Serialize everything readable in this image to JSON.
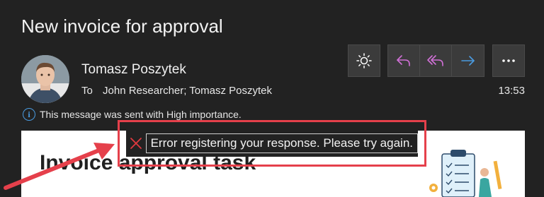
{
  "message": {
    "subject": "New invoice for approval",
    "sender_name": "Tomasz Poszytek",
    "to_label": "To",
    "recipients": "John Researcher; Tomasz Poszytek",
    "time": "13:53",
    "importance_notice": "This message was sent with High importance.",
    "body_heading": "Invoice approval task"
  },
  "toolbar": {
    "buttons": [
      {
        "name": "theme-toggle",
        "icon": "sun-icon"
      },
      {
        "name": "reply",
        "icon": "reply-icon"
      },
      {
        "name": "reply-all",
        "icon": "reply-all-icon"
      },
      {
        "name": "forward",
        "icon": "forward-icon"
      },
      {
        "name": "more",
        "icon": "more-icon"
      }
    ]
  },
  "error_toast": {
    "icon": "close-icon",
    "message": "Error registering your response. Please try again."
  },
  "colors": {
    "background": "#222222",
    "accent_pink": "#d070d6",
    "accent_blue": "#4a9be0",
    "annotation_red": "#e5404b",
    "error_red": "#e0393f"
  }
}
